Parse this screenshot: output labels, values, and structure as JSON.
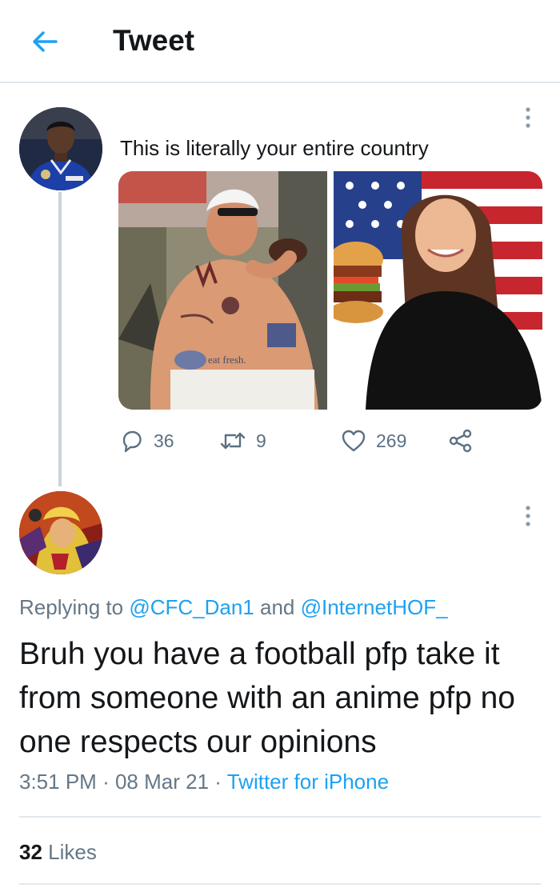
{
  "header": {
    "title": "Tweet",
    "back_icon": "arrow-left-icon",
    "accent": "#1da1f2"
  },
  "tweet": {
    "text": "This is literally your entire country",
    "media": [
      {
        "icon": "photo-man-with-fast-food-tattoos",
        "overlay_text": "eat fresh."
      },
      {
        "icon": "photo-woman-with-burger-and-us-flag"
      }
    ],
    "actions": {
      "reply_count": "36",
      "retweet_count": "9",
      "like_count": "269"
    }
  },
  "reply": {
    "replying_prefix": "Replying to",
    "mention1": "@CFC_Dan1",
    "conjunction": "and",
    "mention2": "@InternetHOF_",
    "text": "Bruh you have  a football pfp take it from someone with an anime pfp no one respects our opinions",
    "time": "3:51 PM",
    "date": "08 Mar 21",
    "source": "Twitter for iPhone",
    "sep": "·",
    "likes_count": "32",
    "likes_label": "Likes"
  }
}
